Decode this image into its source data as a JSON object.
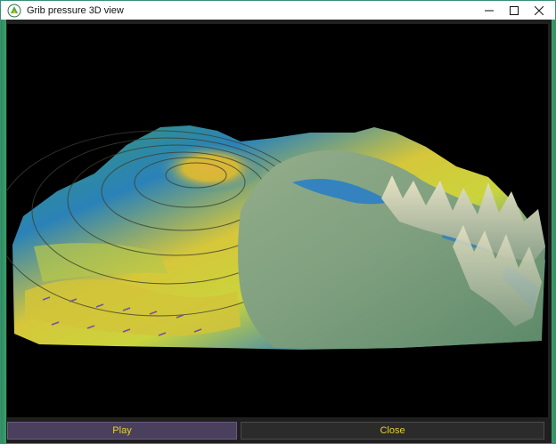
{
  "window": {
    "title": "Grib pressure 3D view",
    "minimize_label": "—",
    "maximize_label": "□",
    "close_label": "✕"
  },
  "buttons": {
    "play_label": "Play",
    "close_label": "Close"
  },
  "colors": {
    "accent_text": "#e6d12a",
    "play_bg": "#4a3f5c",
    "close_bg": "#2b2b2b",
    "viewport_bg": "#000000"
  },
  "icons": {
    "app": "app-logo-icon",
    "minimize": "minimize-icon",
    "maximize": "maximize-icon",
    "close": "close-icon"
  }
}
